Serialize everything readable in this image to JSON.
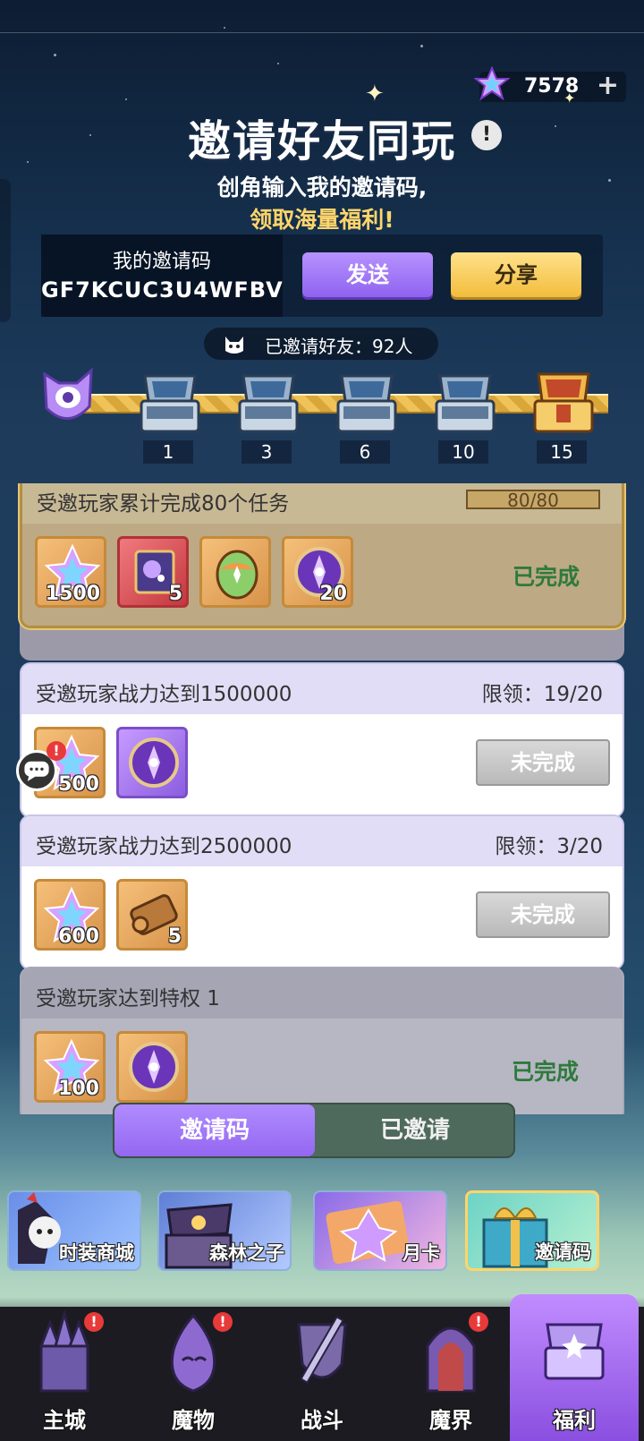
{
  "currency": {
    "value": "7578",
    "plus_label": "+"
  },
  "header": {
    "title": "邀请好友同玩",
    "info_label": "!",
    "subtitle_line1": "创角输入我的邀请码,",
    "subtitle_line2": "领取海量福利!"
  },
  "invite_code": {
    "label": "我的邀请码",
    "value": "GF7KCUC3U4WFBV",
    "send_label": "发送",
    "share_label": "分享"
  },
  "invited": {
    "text": "已邀请好友：92人"
  },
  "milestones": [
    "1",
    "3",
    "6",
    "10",
    "15"
  ],
  "tasks": [
    {
      "title": "受邀玩家累计完成80个任务",
      "progress_text": "80/80",
      "progress": 1.0,
      "status": "已完成",
      "rewards": [
        {
          "icon": "star-crystal-icon",
          "qty": "1500"
        },
        {
          "icon": "cosmic-scroll-icon",
          "qty": "5"
        },
        {
          "icon": "rainbow-egg-icon",
          "qty": ""
        },
        {
          "icon": "purple-emblem-icon",
          "qty": "20"
        }
      ]
    },
    {
      "title": "受邀玩家战力达到1500000",
      "limit": "限领：19/20",
      "status": "未完成",
      "rewards": [
        {
          "icon": "star-crystal-icon",
          "qty": "500"
        },
        {
          "icon": "purple-emblem-icon",
          "qty": ""
        }
      ]
    },
    {
      "title": "受邀玩家战力达到2500000",
      "limit": "限领：3/20",
      "status": "未完成",
      "rewards": [
        {
          "icon": "star-crystal-icon",
          "qty": "600"
        },
        {
          "icon": "bronze-scroll-icon",
          "qty": "5"
        }
      ]
    },
    {
      "title": "受邀玩家达到特权 1",
      "status": "已完成",
      "rewards": [
        {
          "icon": "star-crystal-icon",
          "qty": "100"
        },
        {
          "icon": "purple-emblem-icon",
          "qty": ""
        }
      ]
    }
  ],
  "tabs": {
    "active": "邀请码",
    "inactive": "已邀请"
  },
  "banners": [
    "时装商城",
    "森林之子",
    "月卡",
    "邀请码"
  ],
  "nav": [
    "主城",
    "魔物",
    "战斗",
    "魔界",
    "福利"
  ],
  "colors": {
    "accent_purple": "#9467f1",
    "gold": "#f2bd3c",
    "done_green": "#2e7a3c"
  }
}
